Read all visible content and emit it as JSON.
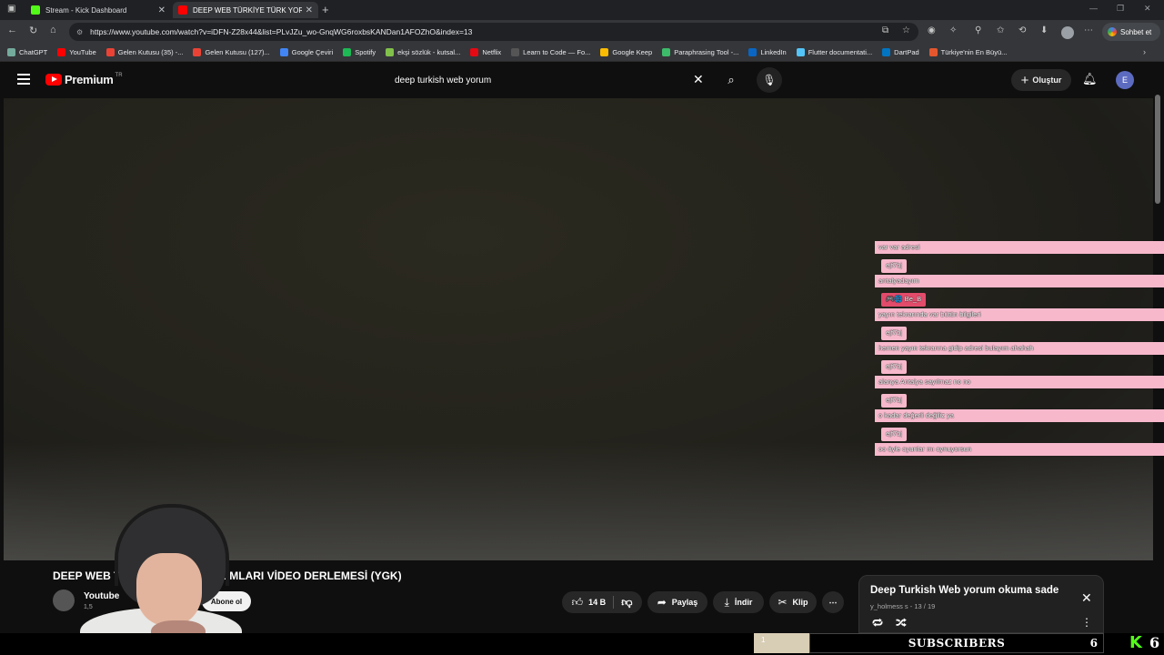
{
  "browser": {
    "tabs": [
      {
        "label": "Stream - Kick Dashboard",
        "favicon_color": "#53fc18"
      },
      {
        "label": "DEEP WEB TÜRKİYE TÜRK YORUM",
        "favicon_color": "#ff0000"
      }
    ],
    "url": "https://www.youtube.com/watch?v=iDFN-Z28x44&list=PLvJZu_wo-GnqWG6roxbsKANDan1AFOZhO&index=13",
    "gemini_label": "Sohbet et",
    "bookmarks": [
      {
        "label": "ChatGPT",
        "color": "#74aa9c"
      },
      {
        "label": "YouTube",
        "color": "#ff0000"
      },
      {
        "label": "Gelen Kutusu (35) -...",
        "color": "#ea4335"
      },
      {
        "label": "Gelen Kutusu (127)...",
        "color": "#ea4335"
      },
      {
        "label": "Google Çeviri",
        "color": "#4285f4"
      },
      {
        "label": "Spotify",
        "color": "#1db954"
      },
      {
        "label": "ekşi sözlük - kutsal...",
        "color": "#81c14b"
      },
      {
        "label": "Netflix",
        "color": "#e50914"
      },
      {
        "label": "Learn to Code — Fo...",
        "color": "#555555"
      },
      {
        "label": "Google Keep",
        "color": "#fbbc04"
      },
      {
        "label": "Paraphrasing Tool -...",
        "color": "#3dbb6b"
      },
      {
        "label": "LinkedIn",
        "color": "#0a66c2"
      },
      {
        "label": "Flutter documentati...",
        "color": "#54c5f8"
      },
      {
        "label": "DartPad",
        "color": "#0175c2"
      },
      {
        "label": "Türkiye'nin En Büyü...",
        "color": "#e4572e"
      }
    ]
  },
  "youtube": {
    "logo_text": "Premium",
    "logo_region": "TR",
    "search_value": "deep turkish web yorum",
    "create_label": "Oluştur",
    "avatar_letter": "E"
  },
  "chat": {
    "messages": [
      {
        "type": "msg",
        "text": "var var adresi"
      },
      {
        "type": "user",
        "text": "ejf7bj"
      },
      {
        "type": "msg",
        "text": "antalyadayım"
      },
      {
        "type": "user_red",
        "text": "🎮🌐 Be_B"
      },
      {
        "type": "msg",
        "text": "yayın tekrarında var bütün bilgileri"
      },
      {
        "type": "user",
        "text": "ejf7bj"
      },
      {
        "type": "msg",
        "text": "hemen yayın tekrarına gidip adresi bulayım ahahah"
      },
      {
        "type": "user",
        "text": "ejf7bj"
      },
      {
        "type": "msg",
        "text": "alanya Antalya sayılmaz no no"
      },
      {
        "type": "user",
        "text": "ejf7bj"
      },
      {
        "type": "msg",
        "text": "o kadar değerli değiliz ya"
      },
      {
        "type": "user",
        "text": "ejf7bj"
      },
      {
        "type": "msg",
        "text": "oo öyle oyunlar mı oynuyorsun"
      }
    ]
  },
  "video": {
    "title": "DEEP WEB TÜRKİYE TÜRK YORUMLARI VİDEO DERLEMESİ (YGK)",
    "channel_name": "Youtube",
    "channel_subs": "1,5",
    "subscribe_label": "Abone ol",
    "likes": "14 B",
    "share_label": "Paylaş",
    "download_label": "İndir",
    "clip_label": "Klip"
  },
  "playlist": {
    "title": "Deep Turkish Web yorum okuma sade",
    "subtitle": "y_holmess s - 13 / 19"
  },
  "kick_overlay": {
    "goal_current": "1",
    "goal_label": "SUBSCRIBERS",
    "goal_target": "6",
    "goal_progress": 0.17,
    "follower_count": "6",
    "brand_color": "#53fc18"
  }
}
